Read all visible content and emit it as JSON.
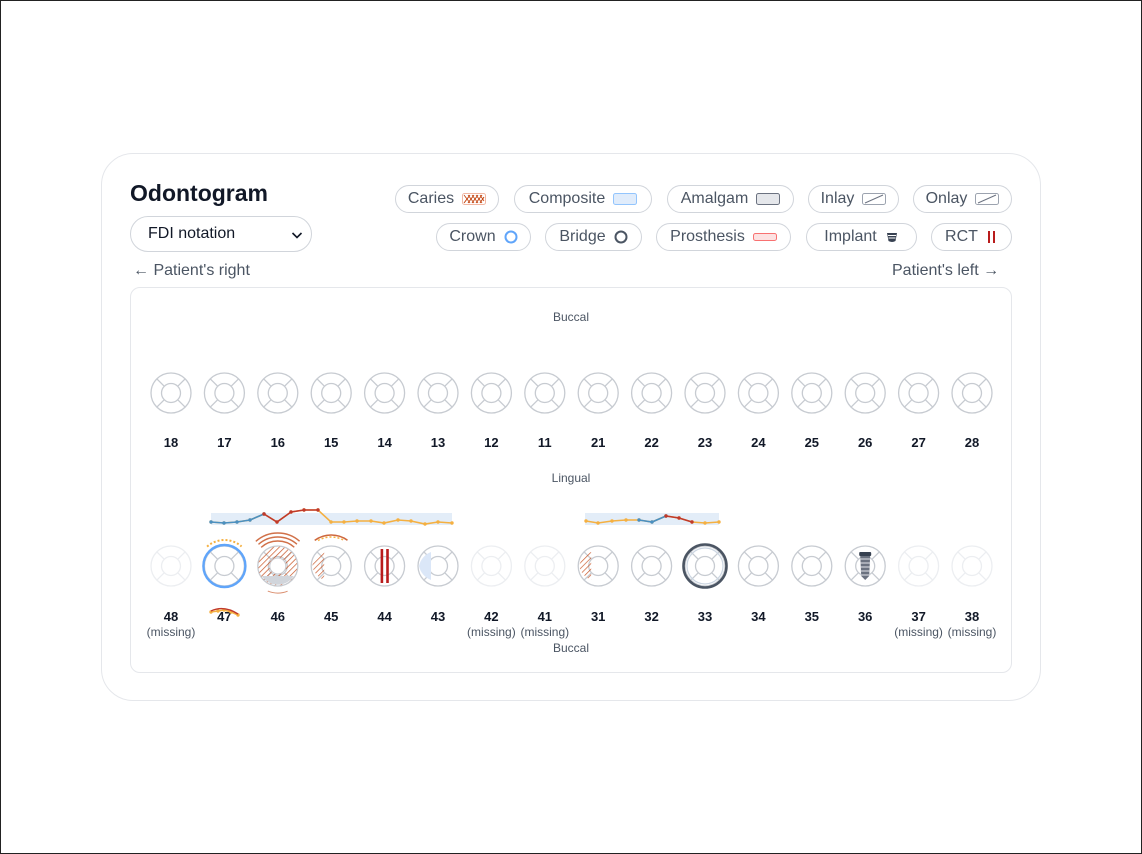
{
  "title": "Odontogram",
  "notation": {
    "selected": "FDI notation"
  },
  "legend": [
    {
      "key": "caries",
      "label": "Caries",
      "icon": "caries-swatch-icon"
    },
    {
      "key": "composite",
      "label": "Composite",
      "icon": "composite-swatch-icon"
    },
    {
      "key": "amalgam",
      "label": "Amalgam",
      "icon": "amalgam-swatch-icon"
    },
    {
      "key": "inlay",
      "label": "Inlay",
      "icon": "inlay-swatch-icon"
    },
    {
      "key": "onlay",
      "label": "Onlay",
      "icon": "onlay-swatch-icon"
    },
    {
      "key": "crown",
      "label": "Crown",
      "icon": "crown-ring-icon"
    },
    {
      "key": "bridge",
      "label": "Bridge",
      "icon": "bridge-ring-icon"
    },
    {
      "key": "prosthesis",
      "label": "Prosthesis",
      "icon": "prosthesis-swatch-icon"
    },
    {
      "key": "implant",
      "label": "Implant",
      "icon": "implant-icon"
    },
    {
      "key": "rct",
      "label": "RCT",
      "icon": "rct-icon"
    }
  ],
  "orientation": {
    "right": "← Patient's right",
    "left": "Patient's left →"
  },
  "surfaces": {
    "upper_top": "Buccal",
    "middle": "Lingual",
    "lower_bottom": "Buccal"
  },
  "upper_teeth": [
    {
      "num": "18"
    },
    {
      "num": "17"
    },
    {
      "num": "16"
    },
    {
      "num": "15"
    },
    {
      "num": "14"
    },
    {
      "num": "13"
    },
    {
      "num": "12"
    },
    {
      "num": "11"
    },
    {
      "num": "21"
    },
    {
      "num": "22"
    },
    {
      "num": "23"
    },
    {
      "num": "24"
    },
    {
      "num": "25"
    },
    {
      "num": "26"
    },
    {
      "num": "27"
    },
    {
      "num": "28"
    }
  ],
  "lower_teeth": [
    {
      "num": "48",
      "missing": true,
      "status": "(missing)"
    },
    {
      "num": "47",
      "treatment": "crown"
    },
    {
      "num": "46",
      "treatment": "caries-amalgam"
    },
    {
      "num": "45",
      "treatment": "caries"
    },
    {
      "num": "44",
      "treatment": "rct"
    },
    {
      "num": "43",
      "treatment": "composite"
    },
    {
      "num": "42",
      "missing": true,
      "status": "(missing)"
    },
    {
      "num": "41",
      "missing": true,
      "status": "(missing)"
    },
    {
      "num": "31",
      "treatment": "caries"
    },
    {
      "num": "32"
    },
    {
      "num": "33",
      "treatment": "bridge"
    },
    {
      "num": "34"
    },
    {
      "num": "35"
    },
    {
      "num": "36",
      "treatment": "implant"
    },
    {
      "num": "37",
      "missing": true,
      "status": "(missing)"
    },
    {
      "num": "38",
      "missing": true,
      "status": "(missing)"
    }
  ],
  "colors": {
    "caries": "#c2410c",
    "composite": "#dbeafe",
    "amalgam": "#9ca3af",
    "crown": "#60a5fa",
    "bridge": "#4b5563",
    "prosthesis": "#f87171",
    "implant": "#374151",
    "rct": "#b91c1c",
    "probe_blue": "#4a90c2",
    "probe_orange": "#f5b041",
    "probe_red": "#c0392b",
    "tooth_outline": "#c7cbd1"
  }
}
